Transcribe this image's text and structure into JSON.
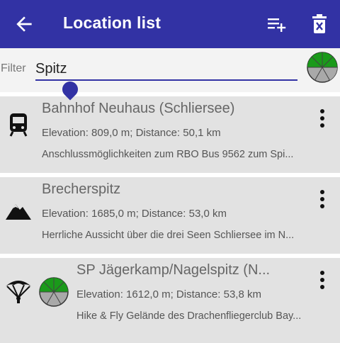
{
  "header": {
    "title": "Location list",
    "back_icon": "arrow-left-icon",
    "add_icon": "playlist-add-icon",
    "delete_icon": "trash-icon",
    "color": "#3232a4"
  },
  "filter": {
    "label": "Filter",
    "value": "Spitz"
  },
  "locations": [
    {
      "name": "Bahnhof Neuhaus (Schliersee)",
      "info": "Elevation: 809,0 m; Distance: 50,1 km",
      "description": "Anschlussmöglichkeiten zum RBO Bus 9562 zum Spi...",
      "icon": "train-icon"
    },
    {
      "name": "Brecherspitz",
      "info": "Elevation: 1685,0 m; Distance: 53,0 km",
      "description": "Herrliche Aussicht über die drei Seen Schliersee im N...",
      "icon": "mountain-icon"
    },
    {
      "name": "SP Jägerkamp/Nagelspitz (N...",
      "info": "Elevation: 1612,0 m; Distance: 53,8 km",
      "description": "Hike & Fly Gelände des Drachenfliegerclub Bay...",
      "icon": "paraglider-icon"
    }
  ]
}
